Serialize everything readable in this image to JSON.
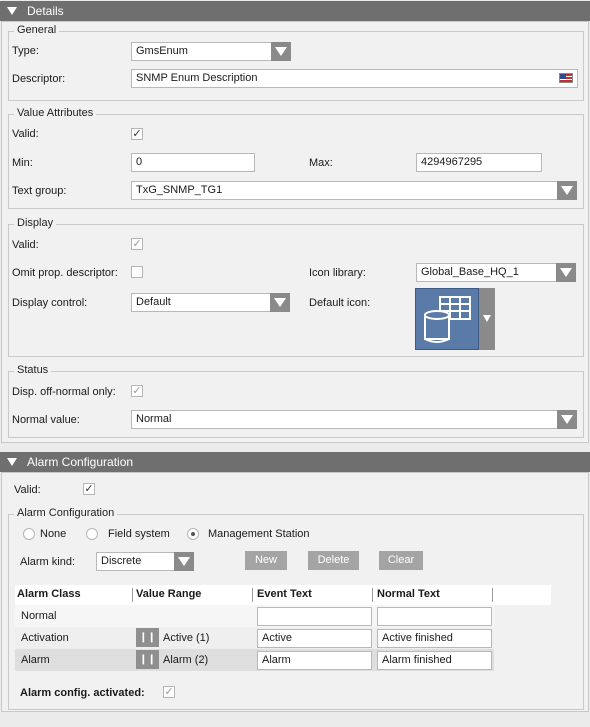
{
  "details": {
    "header": "Details",
    "general": {
      "legend": "General",
      "type_label": "Type:",
      "type_value": "GmsEnum",
      "descriptor_label": "Descriptor:",
      "descriptor_value": "SNMP Enum Description"
    },
    "value_attributes": {
      "legend": "Value Attributes",
      "valid_label": "Valid:",
      "valid_checked": true,
      "min_label": "Min:",
      "min_value": "0",
      "max_label": "Max:",
      "max_value": "4294967295",
      "text_group_label": "Text group:",
      "text_group_value": "TxG_SNMP_TG1"
    },
    "display": {
      "legend": "Display",
      "valid_label": "Valid:",
      "omit_label": "Omit prop. descriptor:",
      "icon_library_label": "Icon library:",
      "icon_library_value": "Global_Base_HQ_1",
      "display_control_label": "Display control:",
      "display_control_value": "Default",
      "default_icon_label": "Default icon:"
    },
    "status": {
      "legend": "Status",
      "disp_label": "Disp. off-normal only:",
      "normal_value_label": "Normal value:",
      "normal_value": "Normal"
    }
  },
  "alarm": {
    "header": "Alarm Configuration",
    "valid_label": "Valid:",
    "group_legend": "Alarm Configuration",
    "radios": [
      "None",
      "Field system",
      "Management Station"
    ],
    "selected_radio": "Management Station",
    "alarm_kind_label": "Alarm kind:",
    "alarm_kind_value": "Discrete",
    "buttons": {
      "new": "New",
      "delete": "Delete",
      "clear": "Clear"
    },
    "table": {
      "headers": [
        "Alarm Class",
        "Value Range",
        "Event Text",
        "Normal Text"
      ],
      "rows": [
        {
          "class": "Normal",
          "range": "",
          "event": "",
          "normal": ""
        },
        {
          "class": "Activation",
          "range": "Active (1)",
          "event": "Active",
          "normal": "Active finished"
        },
        {
          "class": "Alarm",
          "range": "Alarm (2)",
          "event": "Alarm",
          "normal": "Alarm finished"
        }
      ]
    },
    "activated_label": "Alarm config. activated:"
  }
}
